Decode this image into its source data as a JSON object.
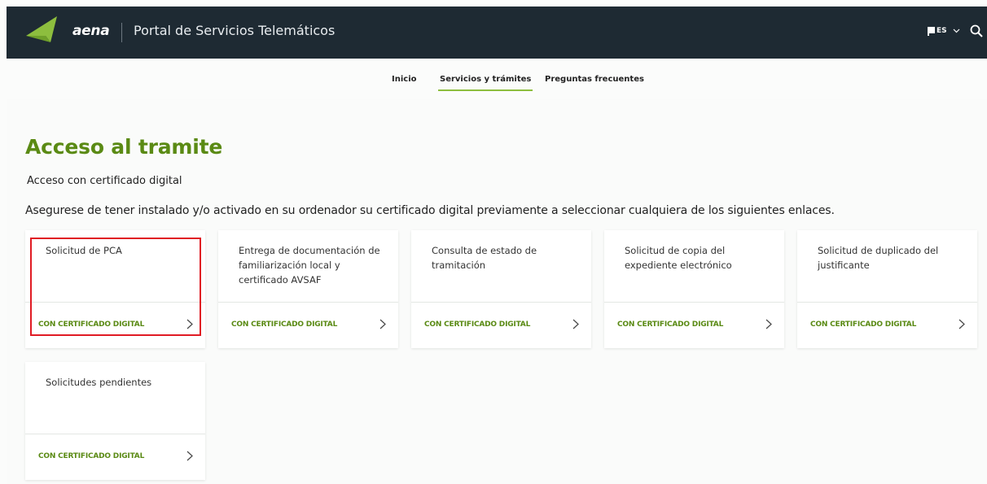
{
  "header": {
    "brand": "aena",
    "portal_title": "Portal de Servicios Telemáticos",
    "language": "ES",
    "icons": [
      "aena-logo-icon",
      "flag-icon",
      "chevron-down-icon",
      "search-icon"
    ]
  },
  "nav": {
    "items": [
      {
        "label": "Inicio",
        "active": false
      },
      {
        "label": "Servicios y trámites",
        "active": true
      },
      {
        "label": "Preguntas frecuentes",
        "active": false
      }
    ]
  },
  "page": {
    "title": "Acceso al tramite",
    "subtitle": "Acceso con certificado digital",
    "description": "Asegurese de tener instalado y/o activado en su ordenador su certificado digital previamente a seleccionar cualquiera de los siguientes enlaces."
  },
  "cards": [
    {
      "title": "Solicitud de PCA",
      "cta": "CON CERTIFICADO DIGITAL",
      "highlighted": true
    },
    {
      "title": "Entrega de documentación de familiarización local y certificado AVSAF",
      "cta": "CON CERTIFICADO DIGITAL",
      "highlighted": false
    },
    {
      "title": "Consulta de estado de tramitación",
      "cta": "CON CERTIFICADO DIGITAL",
      "highlighted": false
    },
    {
      "title": "Solicitud de copia del expediente electrónico",
      "cta": "CON CERTIFICADO DIGITAL",
      "highlighted": false
    },
    {
      "title": "Solicitud de duplicado del justificante",
      "cta": "CON CERTIFICADO DIGITAL",
      "highlighted": false
    },
    {
      "title": "Solicitudes pendientes",
      "cta": "CON CERTIFICADO DIGITAL",
      "highlighted": false
    }
  ],
  "colors": {
    "header_bg": "#1e2a33",
    "brand_green": "#8dbe3e",
    "title_green": "#5a8a14",
    "highlight_red": "#e01b24"
  }
}
